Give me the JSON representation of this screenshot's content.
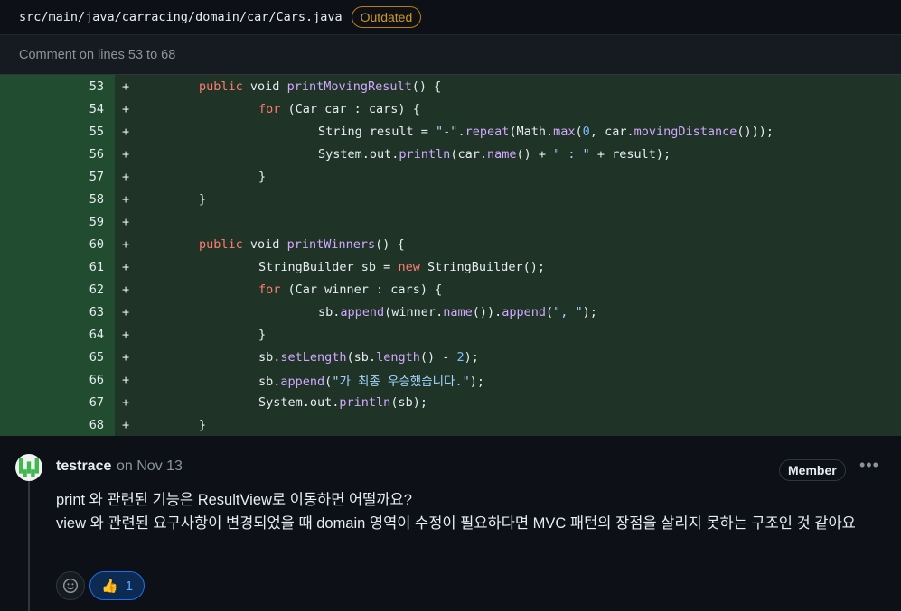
{
  "file": {
    "path": "src/main/java/carracing/domain/car/Cars.java",
    "badge": "Outdated"
  },
  "comment_on": "Comment on lines 53 to 68",
  "diff_lines": [
    {
      "n": "53",
      "plus": "+"
    },
    {
      "n": "54",
      "plus": "+"
    },
    {
      "n": "55",
      "plus": "+"
    },
    {
      "n": "56",
      "plus": "+"
    },
    {
      "n": "57",
      "plus": "+"
    },
    {
      "n": "58",
      "plus": "+"
    },
    {
      "n": "59",
      "plus": "+"
    },
    {
      "n": "60",
      "plus": "+"
    },
    {
      "n": "61",
      "plus": "+"
    },
    {
      "n": "62",
      "plus": "+"
    },
    {
      "n": "63",
      "plus": "+"
    },
    {
      "n": "64",
      "plus": "+"
    },
    {
      "n": "65",
      "plus": "+"
    },
    {
      "n": "66",
      "plus": "+"
    },
    {
      "n": "67",
      "plus": "+"
    },
    {
      "n": "68",
      "plus": "+"
    }
  ],
  "code": {
    "l53": [
      "public",
      " void ",
      "printMovingResult",
      "() {"
    ],
    "l54": [
      "for",
      " (Car car : cars) {"
    ],
    "l55": [
      "String result = ",
      "\"-\"",
      ".",
      "repeat",
      "(Math.",
      "max",
      "(",
      "0",
      ", car.",
      "movingDistance",
      "()));"
    ],
    "l56": [
      "System.out.",
      "println",
      "(car.",
      "name",
      "() + ",
      "\" : \"",
      " + result);"
    ],
    "l57": [
      "}"
    ],
    "l58": [
      "}"
    ],
    "l59": [
      ""
    ],
    "l60": [
      "public",
      " void ",
      "printWinners",
      "() {"
    ],
    "l61": [
      "StringBuilder sb = ",
      "new",
      " StringBuilder();"
    ],
    "l62": [
      "for",
      " (Car winner : cars) {"
    ],
    "l63": [
      "sb.",
      "append",
      "(winner.",
      "name",
      "()).",
      "append",
      "(",
      "\", \"",
      ");"
    ],
    "l64": [
      "}"
    ],
    "l65": [
      "sb.",
      "setLength",
      "(sb.",
      "length",
      "() - ",
      "2",
      ");"
    ],
    "l66": [
      "sb.",
      "append",
      "(",
      "\"가 최종 우승했습니다.\"",
      ");"
    ],
    "l67": [
      "System.out.",
      "println",
      "(sb);"
    ],
    "l68": [
      "}"
    ]
  },
  "comment": {
    "author": "testrace",
    "date": "on Nov 13",
    "role": "Member",
    "more": "•••",
    "body_line1": "print 와 관련된 기능은 ResultView로 이동하면 어떨까요?",
    "body_line2": "view 와 관련된 요구사항이 변경되었을 때 domain 영역이 수정이 필요하다면 MVC 패턴의 장점을 살리지 못하는 구조인 것 같아요",
    "reaction_count": "1"
  },
  "colors": {
    "diff_bg": "#1f3326",
    "gutter_bg": "#214c2f",
    "keyword": "#ff7b72",
    "function": "#d2a8ff",
    "string": "#a5d6ff",
    "number": "#79c0ff",
    "outdated": "#d29922"
  },
  "icons": {
    "avatar": "identicon",
    "add_reaction": "smiley-icon",
    "reaction": "thumbs-up-icon",
    "menu": "kebab-horizontal-icon"
  }
}
